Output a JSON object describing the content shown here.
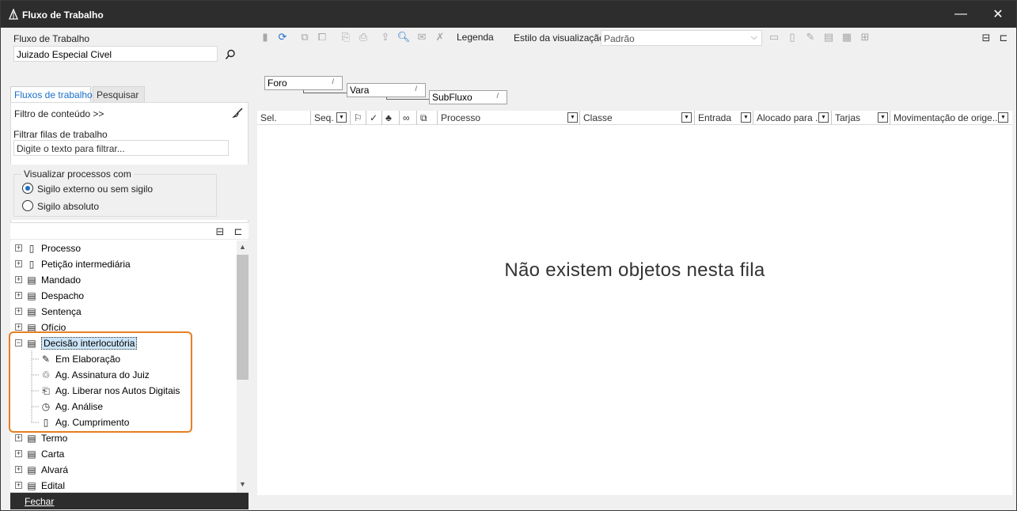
{
  "window": {
    "title": "Fluxo de Trabalho",
    "minimize": "—",
    "close": "✕"
  },
  "workflow": {
    "label": "Fluxo de Trabalho",
    "value": "Juizado Especial Civel"
  },
  "toolbar": {
    "legend_label": "Legenda",
    "style_label": "Estilo da visualização",
    "style_value": "Padrão"
  },
  "tabs": [
    {
      "label": "Fluxos de trabalho",
      "active": true
    },
    {
      "label": "Pesquisar",
      "active": false
    }
  ],
  "filter": {
    "content_filter_label": "Filtro de conteúdo >>",
    "queue_filter_label": "Filtrar filas de trabalho",
    "queue_filter_placeholder": "Digite o texto para filtrar..."
  },
  "visibility": {
    "legend": "Visualizar processos com",
    "options": [
      {
        "label": "Sigilo externo ou sem sigilo",
        "checked": true
      },
      {
        "label": "Sigilo absoluto",
        "checked": false
      }
    ]
  },
  "tree": {
    "top_items": [
      "Processo",
      "Petição intermediária",
      "Mandado",
      "Despacho",
      "Sentença",
      "Ofício"
    ],
    "expanded_item": "Decisão interlocutória",
    "children": [
      "Em Elaboração",
      "Ag. Assinatura do Juiz",
      "Ag. Liberar nos Autos Digitais",
      "Ag. Análise",
      "Ag. Cumprimento"
    ],
    "bottom_items": [
      "Termo",
      "Carta",
      "Alvará",
      "Edital"
    ]
  },
  "footer": {
    "close_label": "Fechar"
  },
  "grouping": [
    "Foro",
    "Vara",
    "SubFluxo"
  ],
  "grid": {
    "columns": [
      "Sel.",
      "Seq.",
      "Processo",
      "Classe",
      "Entrada",
      "Alocado para ...",
      "Tarjas",
      "Movimentação de orige..."
    ],
    "empty_message": "Não existem objetos nesta fila"
  },
  "colors": {
    "accent": "#1a6fc9",
    "highlight": "#e67e22",
    "titlebar": "#2d2d2d"
  }
}
